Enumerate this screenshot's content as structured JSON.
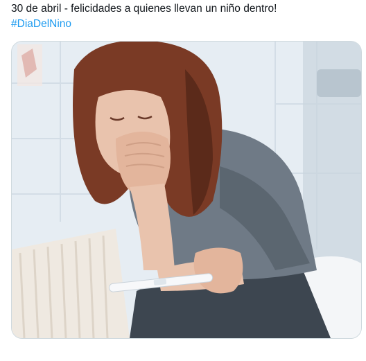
{
  "tweet": {
    "text_line": "30 de abril - felicidades a quienes llevan un niño dentro!",
    "hashtag": "#DiaDelNino"
  },
  "media": {
    "description_icon": "photo-icon",
    "palette": {
      "wall": "#e6edf3",
      "wall_shadow": "#c9d4dd",
      "tile_line": "#d3dde6",
      "radiator": "#efe9e1",
      "hair": "#7a3a25",
      "hair_dark": "#4e2416",
      "skin": "#e9c3ad",
      "skin_shadow": "#cf9f86",
      "sweater": "#6f7a86",
      "sweater_dark": "#4f5863",
      "jeans": "#3d4650",
      "toilet": "#f4f6f8",
      "test_stick": "#f7f8fa"
    }
  }
}
